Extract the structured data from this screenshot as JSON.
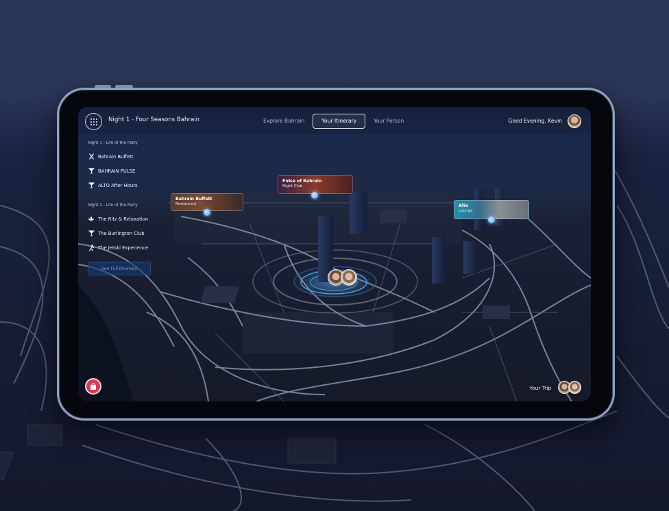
{
  "header": {
    "trip_title": "Night 1 - Four Seasons Bahrain",
    "tabs": [
      {
        "label": "Explore Bahrain",
        "active": false
      },
      {
        "label": "Your Itinerary",
        "active": true
      },
      {
        "label": "Your Person",
        "active": false
      }
    ],
    "greeting": "Good Evening, Kevin"
  },
  "sidebar": {
    "nights": [
      {
        "heading": "Night 1 - Life of the Party",
        "items": [
          {
            "label": "Bahrain Buffett",
            "icon": "fork-knife-icon"
          },
          {
            "label": "BAHRAIN PULSE",
            "icon": "cocktail-icon"
          },
          {
            "label": "ALTO After Hours",
            "icon": "cocktail-icon"
          }
        ]
      },
      {
        "heading": "Night 2 - Life of the Party",
        "items": [
          {
            "label": "The Ritz & Relaxation",
            "icon": "lotus-icon"
          },
          {
            "label": "The Burlington Club",
            "icon": "cocktail-icon"
          },
          {
            "label": "The Jetski Experience",
            "icon": "person-running-icon"
          }
        ]
      }
    ],
    "see_full_itinerary": "See Full Itinerary"
  },
  "map_pins": [
    {
      "title": "Bahrain Buffett",
      "subtitle": "Restaurant"
    },
    {
      "title": "Pulse of Bahrain",
      "subtitle": "Night Club"
    },
    {
      "title": "Alto",
      "subtitle": "Lounge"
    }
  ],
  "footer": {
    "trip_label": "Your Trip"
  },
  "colors": {
    "accent_blue": "#4aa0e6",
    "bag_red": "#d63a52",
    "map_bg": "#0f1a33",
    "road": "#8a93a8"
  }
}
